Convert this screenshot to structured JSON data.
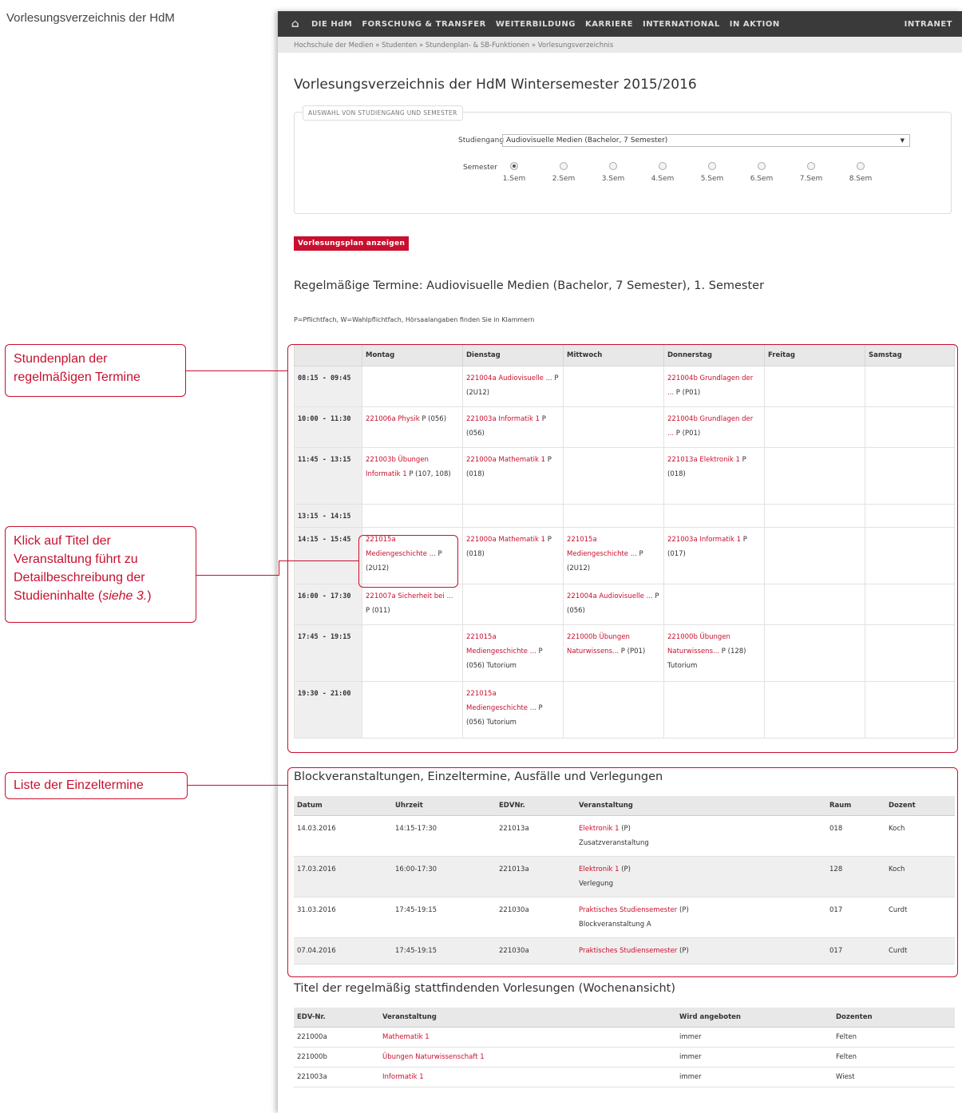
{
  "doc_title": "Vorlesungsverzeichnis der HdM",
  "nav": {
    "items": [
      "DIE HdM",
      "FORSCHUNG & TRANSFER",
      "WEITERBILDUNG",
      "KARRIERE",
      "INTERNATIONAL",
      "IN AKTION"
    ],
    "intranet": "INTRANET"
  },
  "breadcrumb": "Hochschule der Medien » Studenten » Stundenplan- & SB-Funktionen » Vorlesungsverzeichnis",
  "page_title": "Vorlesungsverzeichnis der HdM Wintersemester 2015/2016",
  "selection": {
    "legend": "AUSWAHL VON STUDIENGANG UND SEMESTER",
    "studiengang_label": "Studiengang",
    "studiengang_value": "Audiovisuelle Medien (Bachelor, 7 Semester)",
    "semester_label": "Semester",
    "semesters": [
      "1.Sem",
      "2.Sem",
      "3.Sem",
      "4.Sem",
      "5.Sem",
      "6.Sem",
      "7.Sem",
      "8.Sem"
    ],
    "selected_semester": "1.Sem"
  },
  "show_button": "Vorlesungsplan anzeigen",
  "regular": {
    "heading": "Regelmäßige Termine: Audiovisuelle Medien (Bachelor, 7 Semester), 1. Semester",
    "note": "P=Pflichtfach, W=Wahlpflichtfach, Hörsaalangaben finden Sie in Klammern",
    "days": [
      "Montag",
      "Dienstag",
      "Mittwoch",
      "Donnerstag",
      "Freitag",
      "Samstag"
    ],
    "rows": [
      {
        "time": "08:15 - 09:45",
        "cells": [
          null,
          {
            "link": "221004a Audiovisuelle ...",
            "suffix": " P (2U12)"
          },
          null,
          {
            "link": "221004b Grundlagen der ...",
            "suffix": " P (P01)"
          },
          null,
          null
        ]
      },
      {
        "time": "10:00 - 11:30",
        "cells": [
          {
            "link": "221006a Physik",
            "suffix": " P (056)"
          },
          {
            "link": "221003a Informatik 1",
            "suffix": " P (056)"
          },
          null,
          {
            "link": "221004b Grundlagen der ...",
            "suffix": " P (P01)"
          },
          null,
          null
        ]
      },
      {
        "time": "11:45 - 13:15",
        "cells": [
          {
            "link": "221003b Übungen Informatik 1",
            "suffix": " P (107, 108)"
          },
          {
            "link": "221000a Mathematik 1",
            "suffix": " P (018)"
          },
          null,
          {
            "link": "221013a Elektronik 1",
            "suffix": " P (018)"
          },
          null,
          null
        ]
      },
      {
        "time": "13:15 - 14:15",
        "cells": [
          null,
          null,
          null,
          null,
          null,
          null
        ]
      },
      {
        "time": "14:15 - 15:45",
        "cells": [
          {
            "link": "221015a Mediengeschichte ...",
            "suffix": " P (2U12)"
          },
          {
            "link": "221000a Mathematik 1",
            "suffix": " P (018)"
          },
          {
            "link": "221015a Mediengeschichte ...",
            "suffix": " P (2U12)"
          },
          {
            "link": "221003a Informatik 1",
            "suffix": " P (017)"
          },
          null,
          null
        ]
      },
      {
        "time": "16:00 - 17:30",
        "cells": [
          {
            "link": "221007a Sicherheit bei ...",
            "suffix": " P (011)"
          },
          null,
          {
            "link": "221004a Audiovisuelle ...",
            "suffix": " P (056)"
          },
          null,
          null,
          null
        ]
      },
      {
        "time": "17:45 - 19:15",
        "cells": [
          null,
          {
            "link": "221015a Mediengeschichte ...",
            "suffix": " P (056) Tutorium"
          },
          {
            "link": "221000b Übungen Naturwissens...",
            "suffix": " P (P01)"
          },
          {
            "link": "221000b Übungen Naturwissens...",
            "suffix": " P (128) Tutorium"
          },
          null,
          null
        ]
      },
      {
        "time": "19:30 - 21:00",
        "cells": [
          null,
          {
            "link": "221015a Mediengeschichte ...",
            "suffix": " P (056) Tutorium"
          },
          null,
          null,
          null,
          null
        ]
      }
    ]
  },
  "block": {
    "heading": "Blockveranstaltungen, Einzeltermine, Ausfälle und Verlegungen",
    "headers": [
      "Datum",
      "Uhrzeit",
      "EDVNr.",
      "Veranstaltung",
      "Raum",
      "Dozent"
    ],
    "rows": [
      {
        "datum": "14.03.2016",
        "uhrzeit": "14:15-17:30",
        "edv": "221013a",
        "link": "Elektronik 1",
        "typ": " (P)",
        "note": "Zusatzveranstaltung",
        "raum": "018",
        "dozent": "Koch"
      },
      {
        "datum": "17.03.2016",
        "uhrzeit": "16:00-17:30",
        "edv": "221013a",
        "link": "Elektronik 1",
        "typ": " (P)",
        "note": "Verlegung",
        "raum": "128",
        "dozent": "Koch"
      },
      {
        "datum": "31.03.2016",
        "uhrzeit": "17:45-19:15",
        "edv": "221030a",
        "link": "Praktisches Studiensemester",
        "typ": " (P)",
        "note": "Blockveranstaltung A",
        "raum": "017",
        "dozent": "Curdt"
      },
      {
        "datum": "07.04.2016",
        "uhrzeit": "17:45-19:15",
        "edv": "221030a",
        "link": "Praktisches Studiensemester",
        "typ": " (P)",
        "note": "",
        "raum": "017",
        "dozent": "Curdt"
      }
    ]
  },
  "titles": {
    "heading": "Titel der regelmäßig stattfindenden Vorlesungen (Wochenansicht)",
    "headers": [
      "EDV-Nr.",
      "Veranstaltung",
      "Wird angeboten",
      "Dozenten"
    ],
    "rows": [
      {
        "edv": "221000a",
        "name": "Mathematik 1",
        "angebot": "immer",
        "dozent": "Felten"
      },
      {
        "edv": "221000b",
        "name": "Übungen Naturwissenschaft 1",
        "angebot": "immer",
        "dozent": "Felten"
      },
      {
        "edv": "221003a",
        "name": "Informatik 1",
        "angebot": "immer",
        "dozent": "Wiest"
      }
    ]
  },
  "callouts": {
    "stundenplan": "Stundenplan der regelmäßigen Termine",
    "klick_main": "Klick auf Titel der Veranstaltung führt zu Detailbeschreibung der Studieninhalte (",
    "klick_italic": "siehe 3.",
    "klick_end": ")",
    "liste": "Liste der Einzeltermine"
  },
  "colors": {
    "accent": "#c8102e",
    "nav_bg": "#3a3a3a"
  }
}
